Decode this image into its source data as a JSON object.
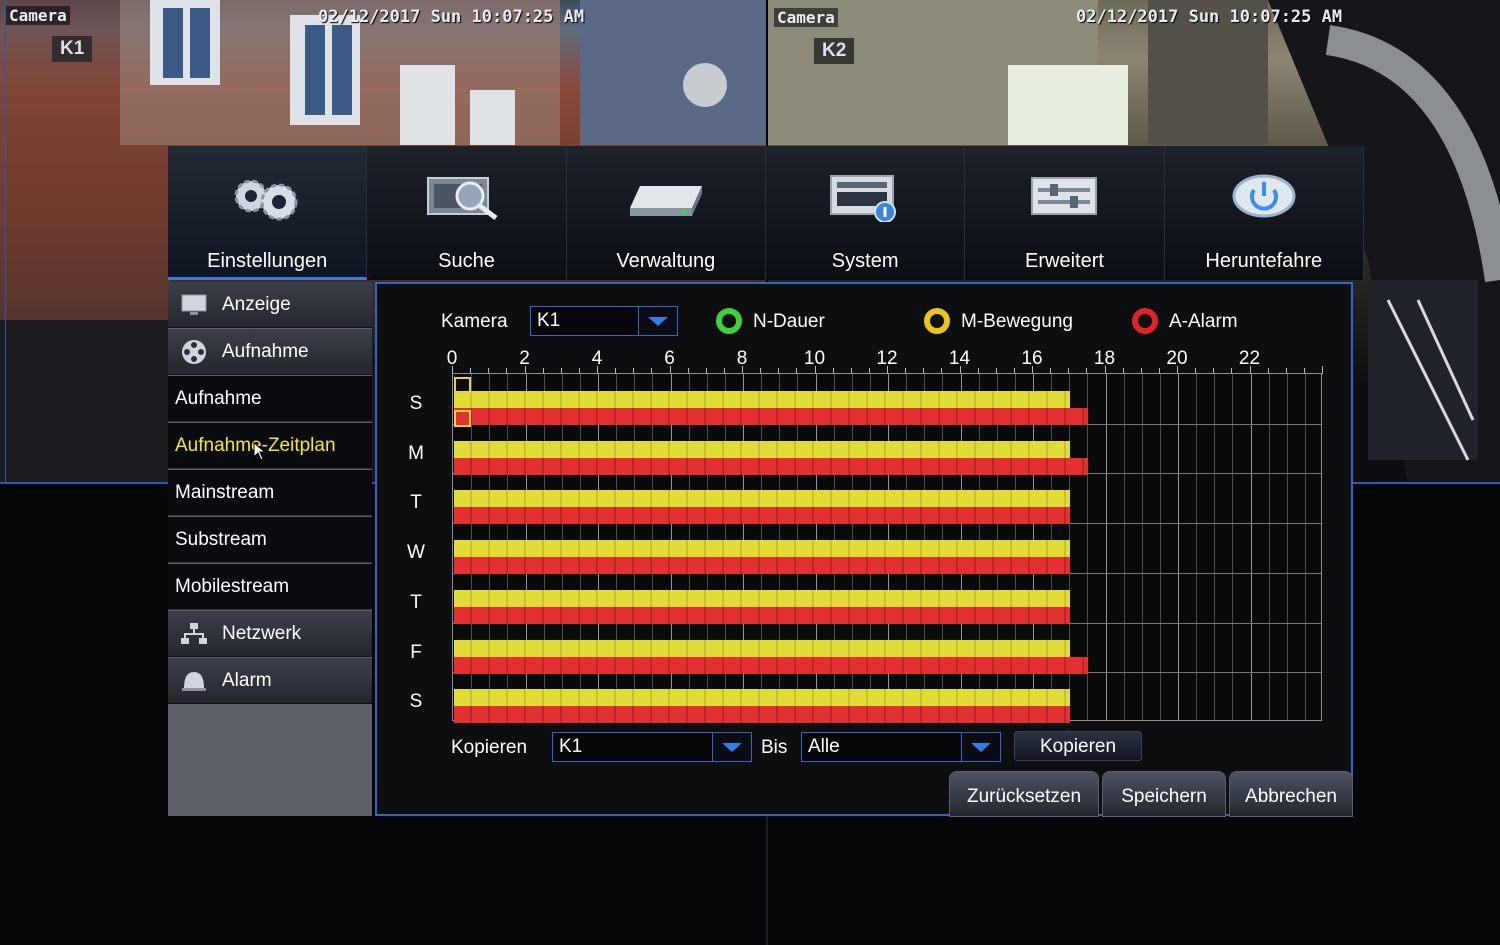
{
  "feeds": [
    {
      "camera": "Camera",
      "channel": "K1",
      "timestamp": "02/12/2017 Sun 10:07:25 AM"
    },
    {
      "camera": "Camera",
      "channel": "K2",
      "timestamp": "02/12/2017 Sun 10:07:25 AM"
    }
  ],
  "top_tabs": [
    {
      "label": "Einstellungen",
      "icon": "gears-icon",
      "active": true
    },
    {
      "label": "Suche",
      "icon": "search-icon",
      "active": false
    },
    {
      "label": "Verwaltung",
      "icon": "hard-drive-icon",
      "active": false
    },
    {
      "label": "System",
      "icon": "system-info-icon",
      "active": false
    },
    {
      "label": "Erweitert",
      "icon": "advanced-icon",
      "active": false
    },
    {
      "label": "Heruntefahre",
      "icon": "power-icon",
      "active": false
    }
  ],
  "sidebar": {
    "items": [
      {
        "label": "Anzeige",
        "type": "category",
        "icon": "monitor-icon"
      },
      {
        "label": "Aufnahme",
        "type": "category",
        "icon": "film-reel-icon"
      },
      {
        "label": "Aufnahme",
        "type": "sub"
      },
      {
        "label": "Aufnahme-Zeitplan",
        "type": "sub",
        "selected": true
      },
      {
        "label": "Mainstream",
        "type": "sub"
      },
      {
        "label": "Substream",
        "type": "sub"
      },
      {
        "label": "Mobilestream",
        "type": "sub"
      },
      {
        "label": "Netzwerk",
        "type": "category",
        "icon": "network-icon"
      },
      {
        "label": "Alarm",
        "type": "category",
        "icon": "alarm-icon"
      }
    ]
  },
  "schedule": {
    "camera_label": "Kamera",
    "camera_value": "K1",
    "legend": [
      {
        "label": "N-Dauer",
        "color": "#3fcf3f"
      },
      {
        "label": "M-Bewegung",
        "color": "#e8c51c"
      },
      {
        "label": "A-Alarm",
        "color": "#e0232a"
      }
    ],
    "hour_labels": [
      "0",
      "2",
      "4",
      "6",
      "8",
      "10",
      "12",
      "14",
      "16",
      "18",
      "20",
      "22"
    ],
    "days": [
      {
        "label": "S",
        "motion_end": 17,
        "alarm_end": 17.5
      },
      {
        "label": "M",
        "motion_end": 17,
        "alarm_end": 17.5
      },
      {
        "label": "T",
        "motion_end": 17,
        "alarm_end": 17
      },
      {
        "label": "W",
        "motion_end": 17,
        "alarm_end": 17
      },
      {
        "label": "T",
        "motion_end": 17,
        "alarm_end": 17
      },
      {
        "label": "F",
        "motion_end": 17,
        "alarm_end": 17.5
      },
      {
        "label": "S",
        "motion_end": 17,
        "alarm_end": 17
      }
    ],
    "copy_label": "Kopieren",
    "copy_from": "K1",
    "bis_label": "Bis",
    "copy_to": "Alle",
    "copy_button": "Kopieren"
  },
  "buttons": {
    "reset": "Zurücksetzen",
    "save": "Speichern",
    "cancel": "Abbrechen"
  },
  "colors": {
    "accent": "#2f65c8",
    "motion": "#e2dc39",
    "alarm": "#e33030",
    "selected_text": "#f3ea2a"
  }
}
